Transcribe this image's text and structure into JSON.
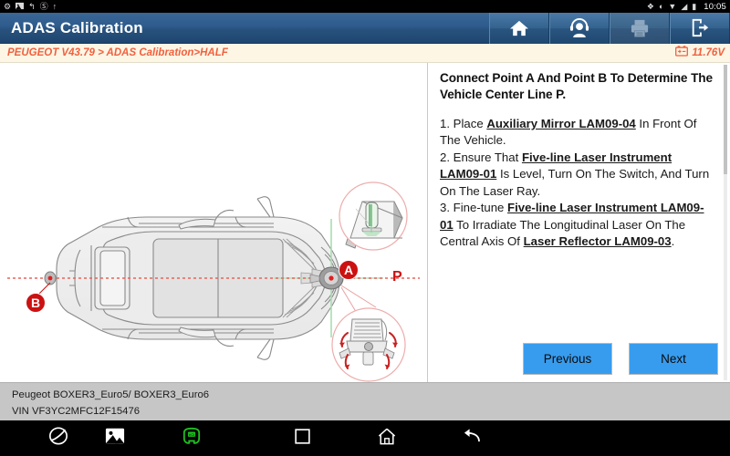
{
  "statusbar": {
    "left_icons": [
      "settings-icon",
      "image-icon",
      "usb-icon",
      "mute-icon",
      "upload-icon"
    ],
    "right_icons": [
      "bluetooth-icon",
      "brightness-icon",
      "wifi-icon",
      "signal-icon",
      "battery-icon"
    ],
    "clock": "10:05"
  },
  "titlebar": {
    "title": "ADAS Calibration",
    "buttons": [
      {
        "name": "home-button",
        "icon": "home-icon",
        "enabled": true
      },
      {
        "name": "support-button",
        "icon": "headset-user-icon",
        "enabled": true
      },
      {
        "name": "print-button",
        "icon": "printer-icon",
        "enabled": false
      },
      {
        "name": "exit-button",
        "icon": "exit-door-icon",
        "enabled": true
      }
    ]
  },
  "breadcrumb": {
    "path": "PEUGEOT V43.79 > ADAS Calibration>HALF",
    "battery_icon": "battery-voltage-icon",
    "voltage": "11.76V"
  },
  "instructions": {
    "heading": "Connect Point A And Point B To Determine The Vehicle Center Line P.",
    "steps": [
      {
        "number": "1.",
        "parts": [
          {
            "text": " Place ",
            "bold": false
          },
          {
            "text": "Auxiliary Mirror LAM09-04",
            "bold": true
          },
          {
            "text": " In Front Of The Vehicle.",
            "bold": false
          }
        ]
      },
      {
        "number": "2.",
        "parts": [
          {
            "text": " Ensure That ",
            "bold": false
          },
          {
            "text": "Five-line Laser Instrument LAM09-01",
            "bold": true
          },
          {
            "text": " Is Level, Turn On The Switch, And Turn On The Laser Ray.",
            "bold": false
          }
        ]
      },
      {
        "number": "3.",
        "parts": [
          {
            "text": " Fine-tune ",
            "bold": false
          },
          {
            "text": "Five-line Laser Instrument LAM09-01",
            "bold": true
          },
          {
            "text": " To Irradiate The Longitudinal Laser On The Central Axis Of ",
            "bold": false
          },
          {
            "text": "Laser Reflector LAM09-03",
            "bold": true
          },
          {
            "text": ".",
            "bold": false
          }
        ]
      }
    ]
  },
  "footer_buttons": {
    "previous": "Previous",
    "next": "Next"
  },
  "vehicle_info": {
    "model": "Peugeot BOXER3_Euro5/ BOXER3_Euro6",
    "vin": "VIN VF3YC2MFC12F15476"
  },
  "navbar": {
    "left_icons": [
      "browser-icon",
      "gallery-icon",
      "vci-icon"
    ],
    "system_icons": [
      "recents-square-icon",
      "home-icon",
      "back-icon"
    ],
    "vci_color": "#1fc01f"
  },
  "diagram": {
    "point_a": "A",
    "point_b": "B",
    "center_line_label": "P",
    "accent_red": "#cc1111",
    "laser_green": "#9fd6a8",
    "callout_pink": "#e8a0a0"
  }
}
